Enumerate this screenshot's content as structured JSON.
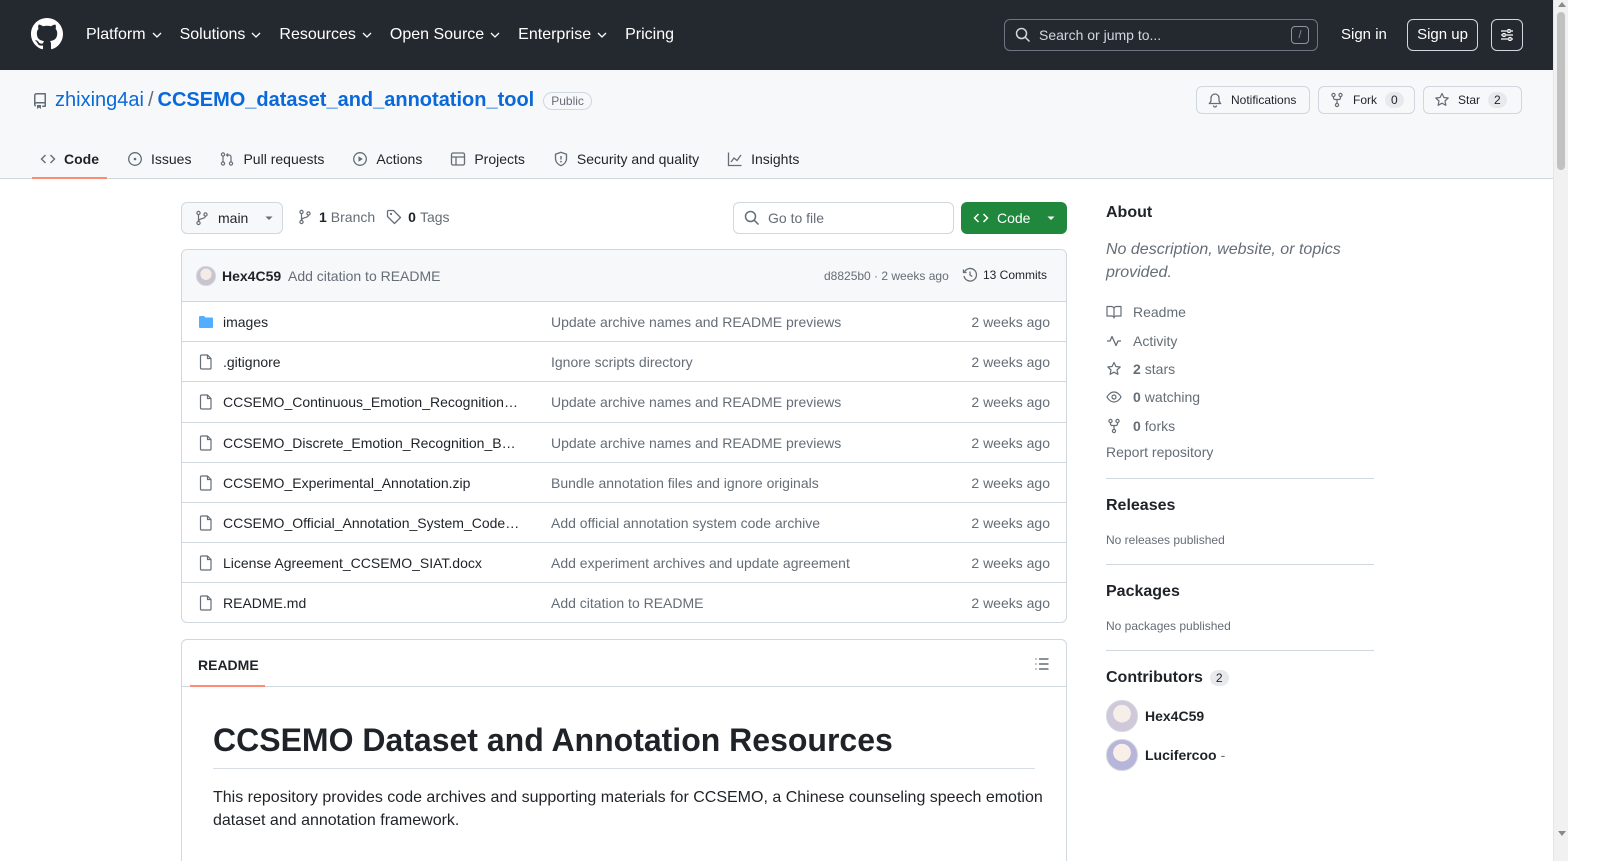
{
  "topnav": {
    "items": [
      "Platform",
      "Solutions",
      "Resources",
      "Open Source",
      "Enterprise",
      "Pricing"
    ],
    "search_placeholder": "Search or jump to...",
    "search_shortcut": "/",
    "sign_in": "Sign in",
    "sign_up": "Sign up"
  },
  "repo": {
    "owner": "zhixing4ai",
    "separator": "/",
    "name": "CCSEMO_dataset_and_annotation_tool",
    "visibility": "Public",
    "notifications_label": "Notifications",
    "fork_label": "Fork",
    "fork_count": "0",
    "star_label": "Star",
    "star_count": "2"
  },
  "tabs": [
    {
      "label": "Code",
      "icon": "code-icon",
      "active": true
    },
    {
      "label": "Issues",
      "icon": "issue-icon"
    },
    {
      "label": "Pull requests",
      "icon": "pull-request-icon"
    },
    {
      "label": "Actions",
      "icon": "play-icon"
    },
    {
      "label": "Projects",
      "icon": "table-icon"
    },
    {
      "label": "Security and quality",
      "icon": "shield-icon"
    },
    {
      "label": "Insights",
      "icon": "graph-icon"
    }
  ],
  "branchbar": {
    "branch": "main",
    "branch_count": "1",
    "branch_label": "Branch",
    "tag_count": "0",
    "tag_label": "Tags",
    "go_to_file": "Go to file",
    "code_button": "Code"
  },
  "latest_commit": {
    "author": "Hex4C59",
    "message": "Add citation to README",
    "sha_time": "d8825b0 · 2 weeks ago",
    "commits": "13 Commits"
  },
  "files": [
    {
      "type": "folder",
      "name": "images",
      "message": "Update archive names and README previews",
      "date": "2 weeks ago"
    },
    {
      "type": "file",
      "name": ".gitignore",
      "message": "Ignore scripts directory",
      "date": "2 weeks ago"
    },
    {
      "type": "file",
      "name": "CCSEMO_Continuous_Emotion_Recognition_…",
      "message": "Update archive names and README previews",
      "date": "2 weeks ago"
    },
    {
      "type": "file",
      "name": "CCSEMO_Discrete_Emotion_Recognition_Ba…",
      "message": "Update archive names and README previews",
      "date": "2 weeks ago"
    },
    {
      "type": "file",
      "name": "CCSEMO_Experimental_Annotation.zip",
      "message": "Bundle annotation files and ignore originals",
      "date": "2 weeks ago"
    },
    {
      "type": "file",
      "name": "CCSEMO_Official_Annotation_System_Code.…",
      "message": "Add official annotation system code archive",
      "date": "2 weeks ago"
    },
    {
      "type": "file",
      "name": "License Agreement_CCSEMO_SIAT.docx",
      "message": "Add experiment archives and update agreement",
      "date": "2 weeks ago"
    },
    {
      "type": "file",
      "name": "README.md",
      "message": "Add citation to README",
      "date": "2 weeks ago"
    }
  ],
  "readme": {
    "tab": "README",
    "heading": "CCSEMO Dataset and Annotation Resources",
    "paragraph": "This repository provides code archives and supporting materials for CCSEMO, a Chinese counseling speech emotion dataset and annotation framework."
  },
  "sidebar": {
    "about_title": "About",
    "description": "No description, website, or topics provided.",
    "readme": "Readme",
    "activity": "Activity",
    "stars_count": "2",
    "stars_label": "stars",
    "watching_count": "0",
    "watching_label": "watching",
    "forks_count": "0",
    "forks_label": "forks",
    "report": "Report repository",
    "releases_title": "Releases",
    "releases_text": "No releases published",
    "packages_title": "Packages",
    "packages_text": "No packages published",
    "contributors_title": "Contributors",
    "contributors_count": "2",
    "contributors": [
      {
        "name": "Hex4C59",
        "suffix": ""
      },
      {
        "name": "Lucifercoo",
        "suffix": "-"
      }
    ]
  },
  "colors": {
    "header_bg": "#24292f",
    "link": "#0969da",
    "primary_button": "#1f883d",
    "active_tab_underline": "#fd8c73"
  }
}
